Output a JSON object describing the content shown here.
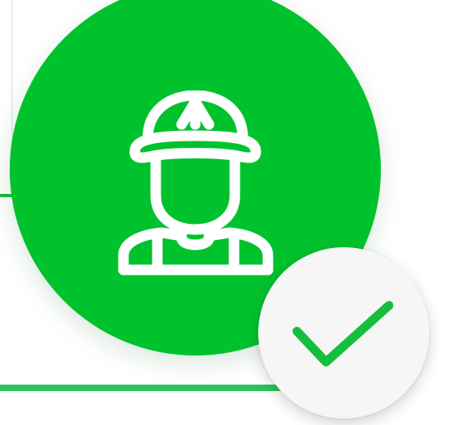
{
  "colors": {
    "primary_green": "#00c22d",
    "line_green": "#2bc45a",
    "badge_background": "#f6f6f6",
    "icon_white": "#ffffff",
    "check_green": "#16be3d"
  },
  "icons": {
    "main": "worker-icon",
    "badge": "checkmark-icon"
  }
}
